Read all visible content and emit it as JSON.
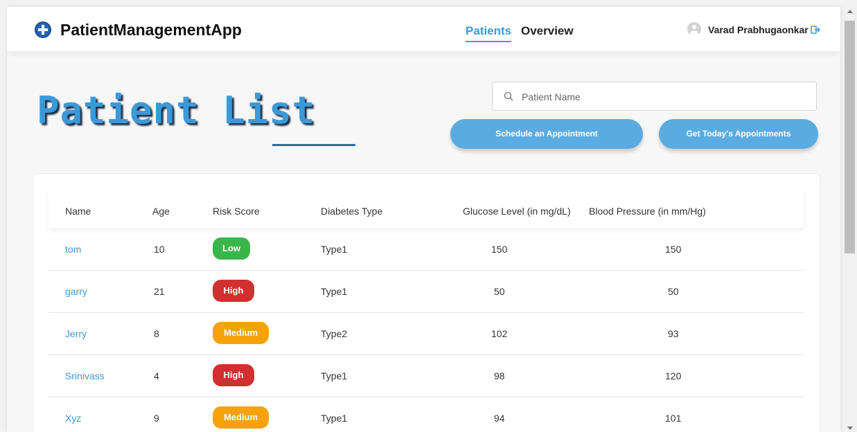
{
  "app": {
    "title": "PatientManagementApp",
    "brand_color": "#2b64ad",
    "accent_color": "#3a9ad9"
  },
  "nav": {
    "items": [
      {
        "label": "Patients",
        "active": true
      },
      {
        "label": "Overview",
        "active": false
      }
    ]
  },
  "user": {
    "name": "Varad Prabhugaonkar",
    "avatar_icon": "user-avatar-icon",
    "logout_icon": "logout-icon"
  },
  "page": {
    "title": "Patient List"
  },
  "search": {
    "placeholder": "Patient Name",
    "value": "",
    "icon": "search-icon"
  },
  "actions": {
    "schedule_label": "Schedule an Appointment",
    "today_label": "Get Today's Appointments"
  },
  "table": {
    "columns": [
      "Name",
      "Age",
      "Risk Score",
      "Diabetes Type",
      "Glucose Level (in mg/dL)",
      "Blood Pressure (in mm/Hg)"
    ],
    "rows": [
      {
        "name": "tom",
        "age": "10",
        "risk": "Low",
        "risk_color": "#3ab54a",
        "diabetes": "Type1",
        "glucose": "150",
        "bp": "150"
      },
      {
        "name": "garry",
        "age": "21",
        "risk": "High",
        "risk_color": "#d0302f",
        "diabetes": "Type1",
        "glucose": "50",
        "bp": "50"
      },
      {
        "name": "Jerry",
        "age": "8",
        "risk": "Medium",
        "risk_color": "#f5a20b",
        "diabetes": "Type2",
        "glucose": "102",
        "bp": "93"
      },
      {
        "name": "Srinivass",
        "age": "4",
        "risk": "High",
        "risk_color": "#d0302f",
        "diabetes": "Type1",
        "glucose": "98",
        "bp": "120"
      },
      {
        "name": "Xyz",
        "age": "9",
        "risk": "Medium",
        "risk_color": "#f5a20b",
        "diabetes": "Type1",
        "glucose": "94",
        "bp": "101"
      }
    ]
  }
}
